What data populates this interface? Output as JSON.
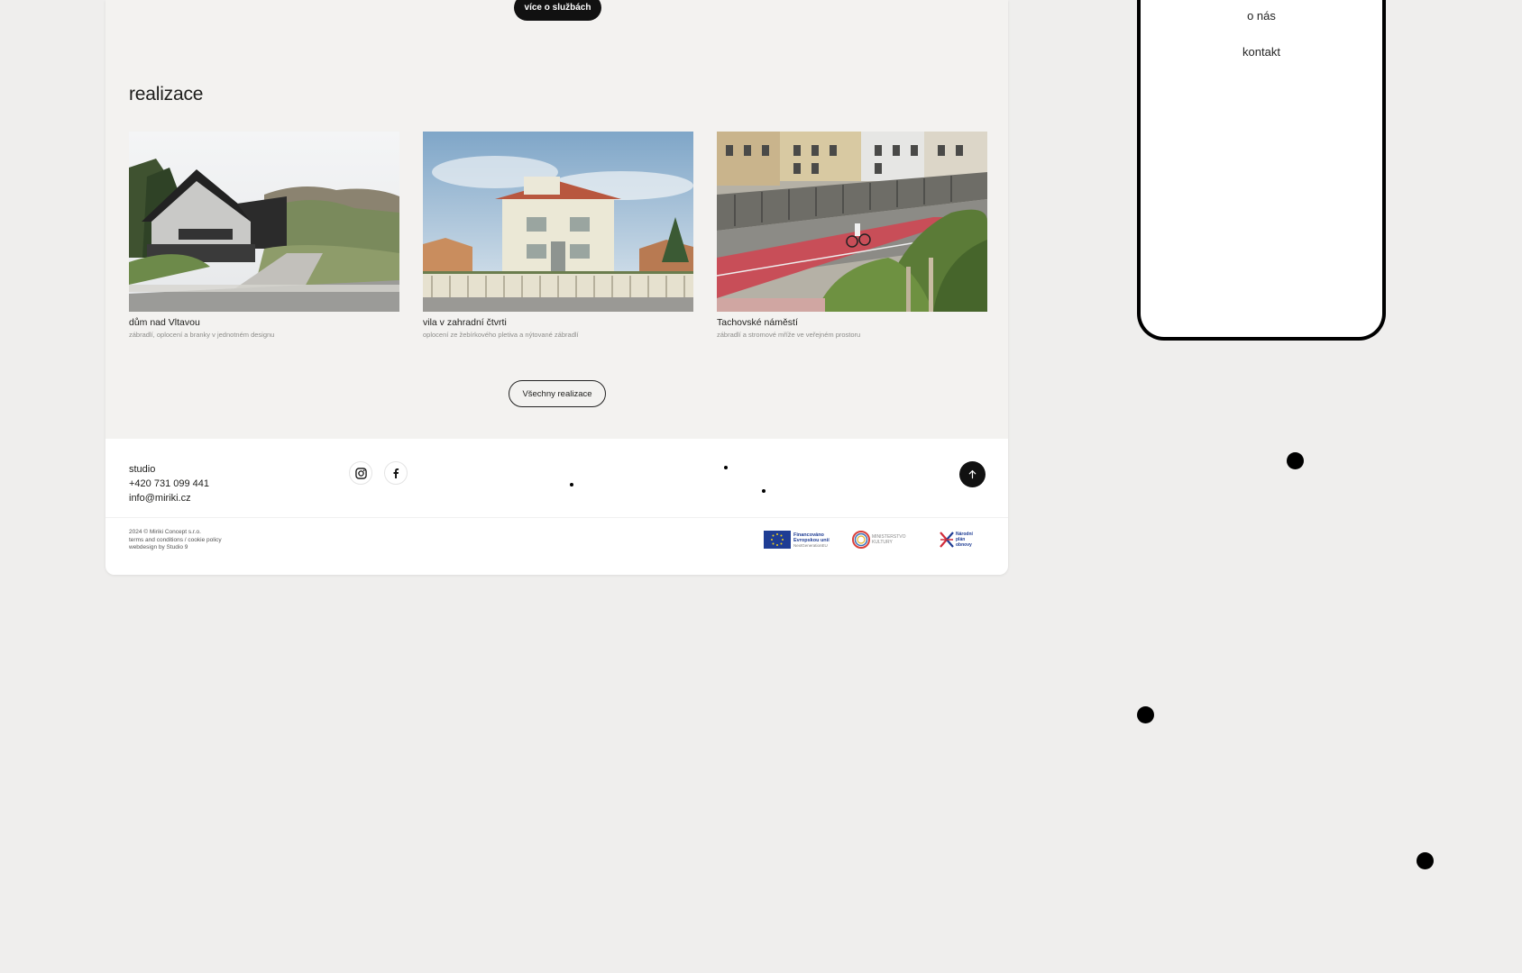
{
  "services": {
    "more_label": "více o službách"
  },
  "realizace": {
    "title": "realizace",
    "projects": [
      {
        "title": "dům nad Vltavou",
        "subtitle": "zábradlí, oplocení a branky v jednotném designu"
      },
      {
        "title": "vila v zahradní čtvrti",
        "subtitle": "oplocení ze žebírkového pletiva a nýtované zábradlí"
      },
      {
        "title": "Tachovské náměstí",
        "subtitle": "zábradlí a stromové mříže ve veřejném prostoru"
      }
    ],
    "all_label": "Všechny realizace"
  },
  "footer": {
    "studio": "studio",
    "phone": "+420 731 099 441",
    "email": "info@miriki.cz",
    "copyright": "2024 © Miriki Concept s.r.o.",
    "terms": "terms and conditions / cookie policy",
    "credit": "webdesign by Studio 9",
    "logos": {
      "eu_line1": "Financováno",
      "eu_line2": "Evropskou unií",
      "eu_line3": "NextGenerationEU",
      "mk_line1": "MINISTERSTVO",
      "mk_line2": "KULTURY",
      "npo_line1": "Národní",
      "npo_line2": "plán",
      "npo_line3": "obnovy"
    }
  },
  "phone_menu": {
    "items": [
      "o nás",
      "kontakt"
    ]
  },
  "colors": {
    "accent": "#111111",
    "page_bg": "#f3f2f0",
    "outer_bg": "#efeeed"
  }
}
